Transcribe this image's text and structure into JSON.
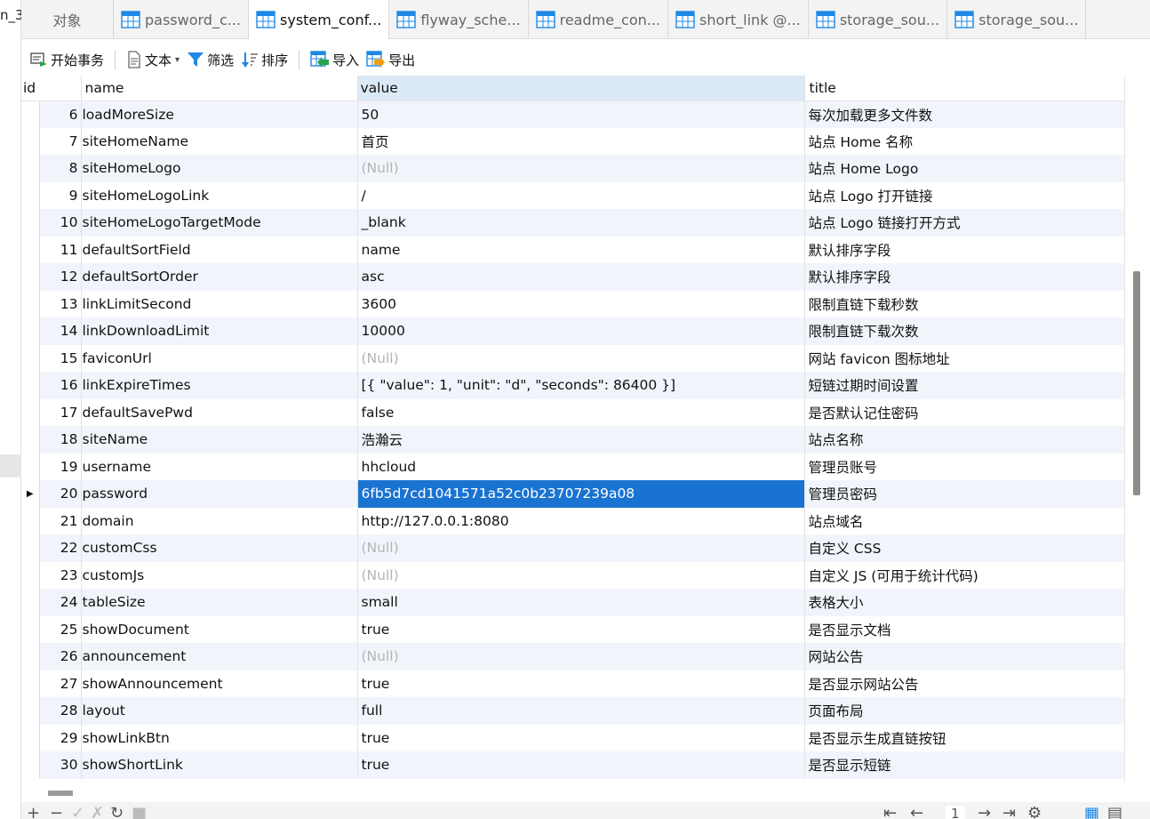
{
  "left_strip": {
    "cut_text": "n_3"
  },
  "tabs": [
    {
      "label": "对象",
      "type": "objects",
      "active": false
    },
    {
      "label": "password_c...",
      "type": "table",
      "active": false
    },
    {
      "label": "system_conf...",
      "type": "table",
      "active": true
    },
    {
      "label": "flyway_sche...",
      "type": "table",
      "active": false
    },
    {
      "label": "readme_con...",
      "type": "table",
      "active": false
    },
    {
      "label": "short_link @...",
      "type": "table",
      "active": false
    },
    {
      "label": "storage_sou...",
      "type": "table",
      "active": false
    },
    {
      "label": "storage_sou...",
      "type": "table",
      "active": false
    }
  ],
  "toolbar": {
    "begin_transaction": "开始事务",
    "text": "文本",
    "filter": "筛选",
    "sort": "排序",
    "import": "导入",
    "export": "导出"
  },
  "columns": {
    "id": "id",
    "name": "name",
    "value": "value",
    "title": "title"
  },
  "null_text": "(Null)",
  "rows": [
    {
      "id": "6",
      "name": "loadMoreSize",
      "value": "50",
      "title": "每次加载更多文件数"
    },
    {
      "id": "7",
      "name": "siteHomeName",
      "value": "首页",
      "title": "站点 Home 名称"
    },
    {
      "id": "8",
      "name": "siteHomeLogo",
      "value": null,
      "title": "站点 Home Logo"
    },
    {
      "id": "9",
      "name": "siteHomeLogoLink",
      "value": "/",
      "title": "站点 Logo 打开链接"
    },
    {
      "id": "10",
      "name": "siteHomeLogoTargetMode",
      "value": "_blank",
      "title": "站点 Logo 链接打开方式"
    },
    {
      "id": "11",
      "name": "defaultSortField",
      "value": "name",
      "title": "默认排序字段"
    },
    {
      "id": "12",
      "name": "defaultSortOrder",
      "value": "asc",
      "title": "默认排序字段"
    },
    {
      "id": "13",
      "name": "linkLimitSecond",
      "value": "3600",
      "title": "限制直链下载秒数"
    },
    {
      "id": "14",
      "name": "linkDownloadLimit",
      "value": "10000",
      "title": "限制直链下载次数"
    },
    {
      "id": "15",
      "name": "faviconUrl",
      "value": null,
      "title": "网站 favicon 图标地址"
    },
    {
      "id": "16",
      "name": "linkExpireTimes",
      "value": "[{ \"value\": 1, \"unit\": \"d\", \"seconds\": 86400 }]",
      "title": "短链过期时间设置"
    },
    {
      "id": "17",
      "name": "defaultSavePwd",
      "value": "false",
      "title": "是否默认记住密码"
    },
    {
      "id": "18",
      "name": "siteName",
      "value": "浩瀚云",
      "title": "站点名称"
    },
    {
      "id": "19",
      "name": "username",
      "value": "hhcloud",
      "title": "管理员账号"
    },
    {
      "id": "20",
      "name": "password",
      "value": "6fb5d7cd1041571a52c0b23707239a08",
      "title": "管理员密码",
      "current": true
    },
    {
      "id": "21",
      "name": "domain",
      "value": "http://127.0.0.1:8080",
      "title": "站点域名"
    },
    {
      "id": "22",
      "name": "customCss",
      "value": null,
      "title": "自定义 CSS"
    },
    {
      "id": "23",
      "name": "customJs",
      "value": null,
      "title": "自定义 JS (可用于统计代码)"
    },
    {
      "id": "24",
      "name": "tableSize",
      "value": "small",
      "title": "表格大小"
    },
    {
      "id": "25",
      "name": "showDocument",
      "value": "true",
      "title": "是否显示文档"
    },
    {
      "id": "26",
      "name": "announcement",
      "value": null,
      "title": "网站公告"
    },
    {
      "id": "27",
      "name": "showAnnouncement",
      "value": "true",
      "title": "是否显示网站公告"
    },
    {
      "id": "28",
      "name": "layout",
      "value": "full",
      "title": "页面布局"
    },
    {
      "id": "29",
      "name": "showLinkBtn",
      "value": "true",
      "title": "是否显示生成直链按钮"
    },
    {
      "id": "30",
      "name": "showShortLink",
      "value": "true",
      "title": "是否显示短链"
    }
  ],
  "pagination": {
    "page": "1"
  },
  "colors": {
    "selection": "#1a73d1",
    "alt_row": "#f1f5fb",
    "header_highlight": "#dce9f7",
    "null_text": "#b4b4b4"
  }
}
